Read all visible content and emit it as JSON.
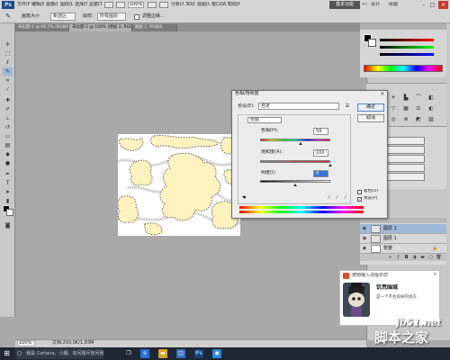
{
  "menubar": {
    "items": [
      "文件(F)",
      "编辑(E)",
      "图像(I)",
      "图层(L)",
      "选择(S)",
      "滤镜(T)",
      "分析(A)",
      "3D(D)",
      "视图(V)",
      "窗口(W)",
      "帮助(H)"
    ],
    "zoom": "100%",
    "workspace_active": "基本功能",
    "workspace_options": [
      ">>",
      "设计",
      "绘画"
    ]
  },
  "options_bar": {
    "brush_size_label": "画笔大小",
    "sample_label": "取样:",
    "sample_value": "所有图层",
    "mode_value": "新选区",
    "auto_enhance": "自动增强",
    "refine_edge": "调整边缘..."
  },
  "document_tabs": [
    "未标题-1 @ 66.7% (RGB/8)",
    "未标题-2 @ 100% (图层 2, RGB/8)",
    "图层 1, RGB/8"
  ],
  "status_bar": {
    "zoom": "100%",
    "doc_info": "文档:293.0K/1.83M"
  },
  "hue_sat_dialog": {
    "title": "色相/饱和度",
    "preset_label": "预设(E):",
    "preset_value": "自定",
    "ok": "确定",
    "cancel": "取消",
    "edit_value": "全图",
    "hue_label": "色相(H):",
    "hue_value": "59",
    "saturation_label": "饱和度(A):",
    "saturation_value": "100",
    "lightness_label": "明度(I):",
    "lightness_value": "0",
    "colorize_label": "着色(O)",
    "preview_label": "预览(P)",
    "colorize_checked": false,
    "preview_checked": true,
    "hue_fraction": 0.58,
    "saturation_fraction": 1.0,
    "lightness_fraction": 0.5
  },
  "layers_panel": {
    "layers": [
      {
        "name": "图层 2",
        "selected": true
      },
      {
        "name": "图层 1",
        "selected": false
      },
      {
        "name": "背景",
        "selected": false
      }
    ]
  },
  "ime_notification": {
    "title": "搜狗输入法提示您",
    "headline": "饥荒围城",
    "body": "是一个不会丢掉的地方"
  },
  "taskbar": {
    "search_text": "我是 Cortana，小娜。有问题尽管问我。"
  },
  "watermark": {
    "site": "jb51.net",
    "name": "脚本之家"
  },
  "colors": {
    "selection_fill": "#fff2bf",
    "accent_blue": "#3a74d6",
    "close_red": "#c73d33"
  }
}
